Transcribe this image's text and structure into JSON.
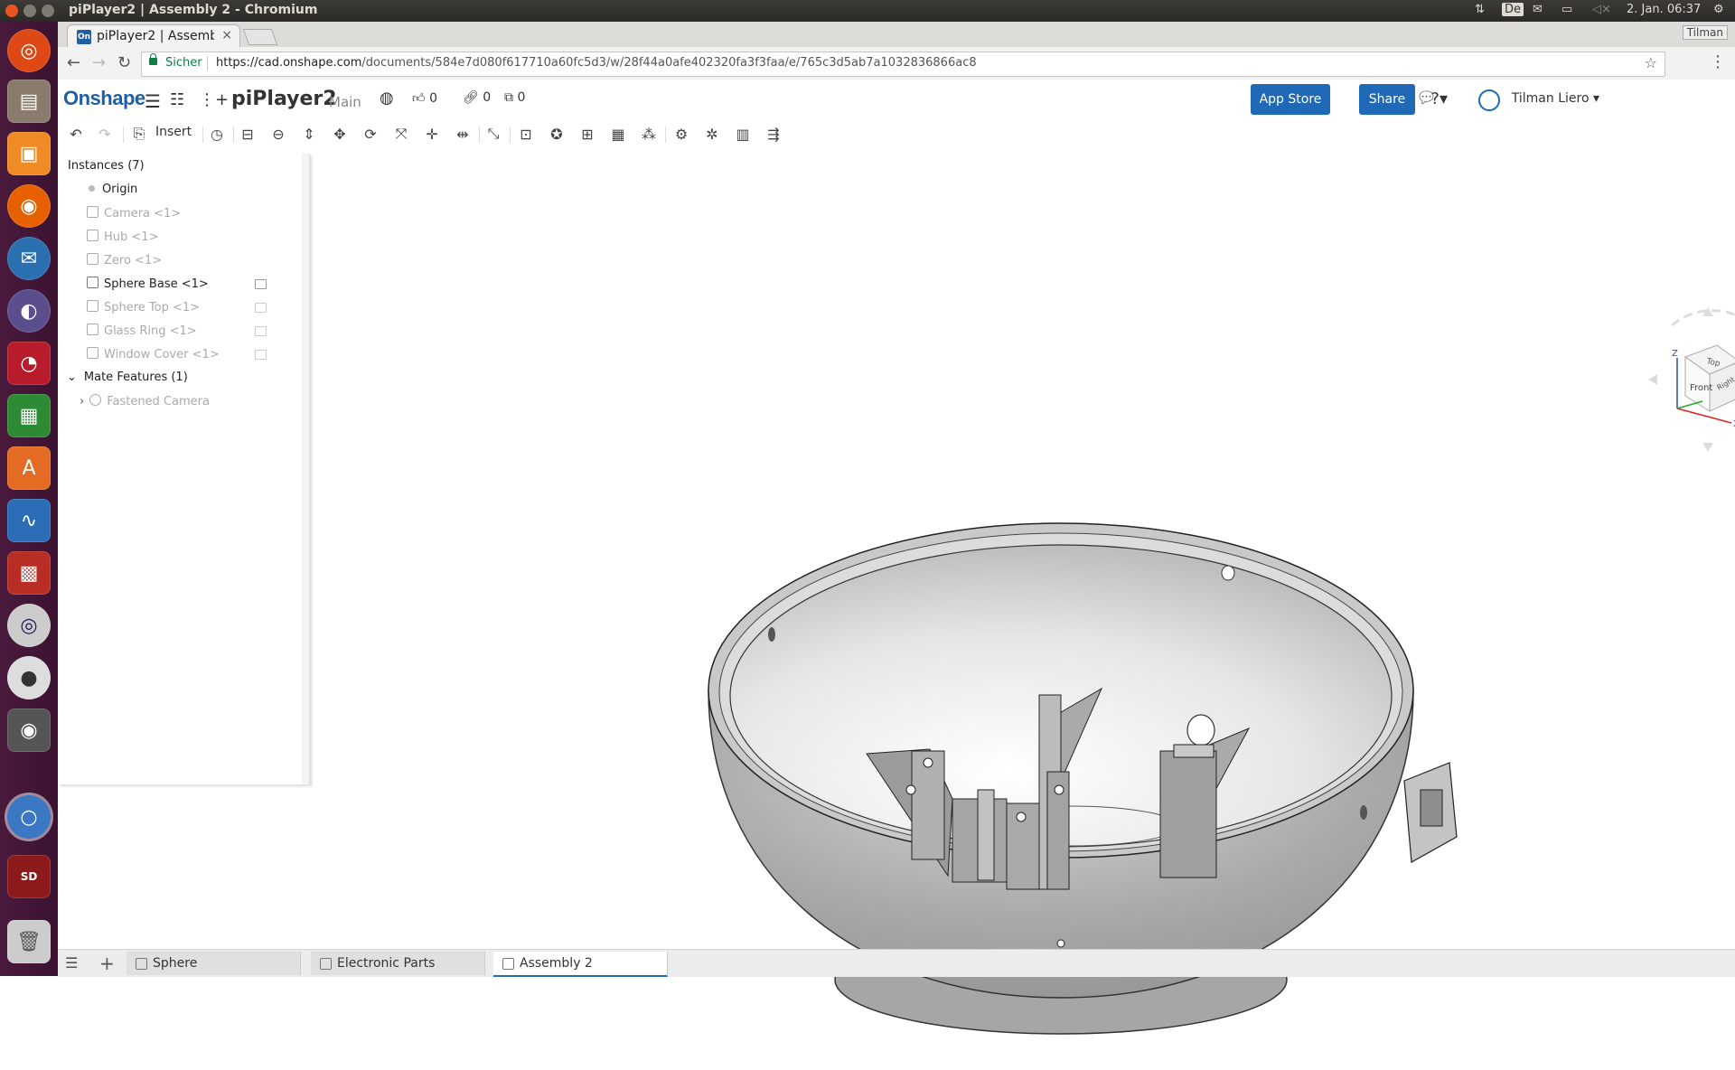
{
  "window": {
    "title": "piPlayer2 | Assembly 2 - Chromium",
    "indicators": {
      "keyboard": "De",
      "datetime": "2. Jan. 06:37"
    }
  },
  "launcher": {
    "items": [
      "ubuntu-dash",
      "files",
      "workspace",
      "firefox",
      "thunderbird",
      "eclipse",
      "openshot",
      "spreadsheet",
      "software-center",
      "system-monitor",
      "qr-tool",
      "media",
      "media-player",
      "webcam",
      "chromium",
      "sd-card",
      "trash"
    ]
  },
  "browser": {
    "tab_title": "piPlayer2 | Assembly 2",
    "tab_close": "×",
    "profile": "Tilman",
    "secure_label": "Sicher",
    "url_host": "https://cad.onshape.com",
    "url_path": "/documents/584e7d080f617710a60fc5d3/w/28f44a0afe402320fa3f3faa/e/765c3d5ab7a1032836866ac8"
  },
  "header": {
    "logo": "Onshape",
    "doc_title": "piPlayer2",
    "workspace": "Main",
    "likes": "0",
    "links": "0",
    "copies": "0",
    "app_store": "App Store",
    "share": "Share",
    "user_name": "Tilman Liero"
  },
  "toolbar": {
    "insert_label": "Insert"
  },
  "feature_tree": {
    "instances_header": "Instances (7)",
    "origin": "Origin",
    "instances": [
      {
        "label": "Camera <1>",
        "style": "dim",
        "mated": false
      },
      {
        "label": "Hub <1>",
        "style": "dim",
        "mated": false
      },
      {
        "label": "Zero <1>",
        "style": "dim",
        "mated": false
      },
      {
        "label": "Sphere Base <1>",
        "style": "dark",
        "mated": true
      },
      {
        "label": "Sphere Top <1>",
        "style": "dim",
        "mated": true
      },
      {
        "label": "Glass Ring <1>",
        "style": "dim",
        "mated": true
      },
      {
        "label": "Window Cover <1>",
        "style": "dim",
        "mated": true
      }
    ],
    "mates_header": "Mate Features (1)",
    "mates": [
      {
        "label": "Fastened Camera"
      }
    ]
  },
  "view_cube": {
    "faces": [
      "Top",
      "Front",
      "Right"
    ],
    "axes": [
      "Z",
      "X"
    ]
  },
  "bottom_tabs": {
    "tabs": [
      {
        "label": "Sphere",
        "active": false
      },
      {
        "label": "Electronic Parts",
        "active": false
      },
      {
        "label": "Assembly 2",
        "active": true
      }
    ]
  },
  "colors": {
    "accent": "#1f69b6",
    "logo": "#1f5fa5",
    "secure": "#0b8043",
    "launcher": "#4a1a3d"
  }
}
